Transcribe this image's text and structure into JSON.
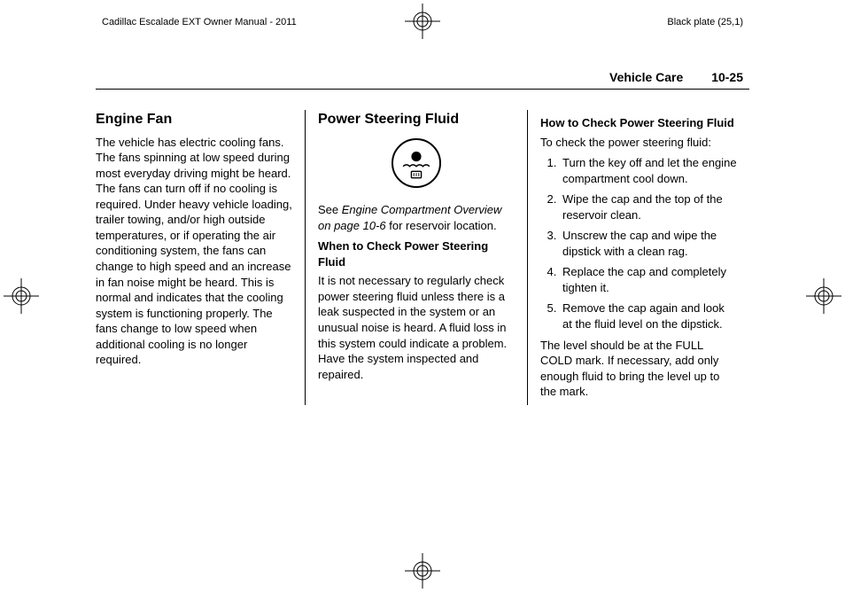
{
  "top": {
    "left": "Cadillac Escalade EXT Owner Manual - 2011",
    "right": "Black plate (25,1)"
  },
  "header": {
    "section": "Vehicle Care",
    "pageno": "10-25"
  },
  "col1": {
    "h2": "Engine Fan",
    "p1": "The vehicle has electric cooling fans. The fans spinning at low speed during most everyday driving might be heard. The fans can turn off if no cooling is required. Under heavy vehicle loading, trailer towing, and/or high outside temperatures, or if operating the air conditioning system, the fans can change to high speed and an increase in fan noise might be heard. This is normal and indicates that the cooling system is functioning properly. The fans change to low speed when additional cooling is no longer required."
  },
  "col2": {
    "h2": "Power Steering Fluid",
    "see_prefix": "See ",
    "see_italic": "Engine Compartment Overview on page 10-6",
    "see_suffix": " for reservoir location.",
    "h3a": "When to Check Power Steering Fluid",
    "p2": "It is not necessary to regularly check power steering fluid unless there is a leak suspected in the system or an unusual noise is heard. A fluid loss in this system could indicate a problem. Have the system inspected and repaired."
  },
  "col3": {
    "h3a": "How to Check Power Steering Fluid",
    "intro": "To check the power steering fluid:",
    "steps": [
      "Turn the key off and let the engine compartment cool down.",
      "Wipe the cap and the top of the reservoir clean.",
      "Unscrew the cap and wipe the dipstick with a clean rag.",
      "Replace the cap and completely tighten it.",
      "Remove the cap again and look at the fluid level on the dipstick."
    ],
    "outro": "The level should be at the FULL COLD mark. If necessary, add only enough fluid to bring the level up to the mark."
  }
}
